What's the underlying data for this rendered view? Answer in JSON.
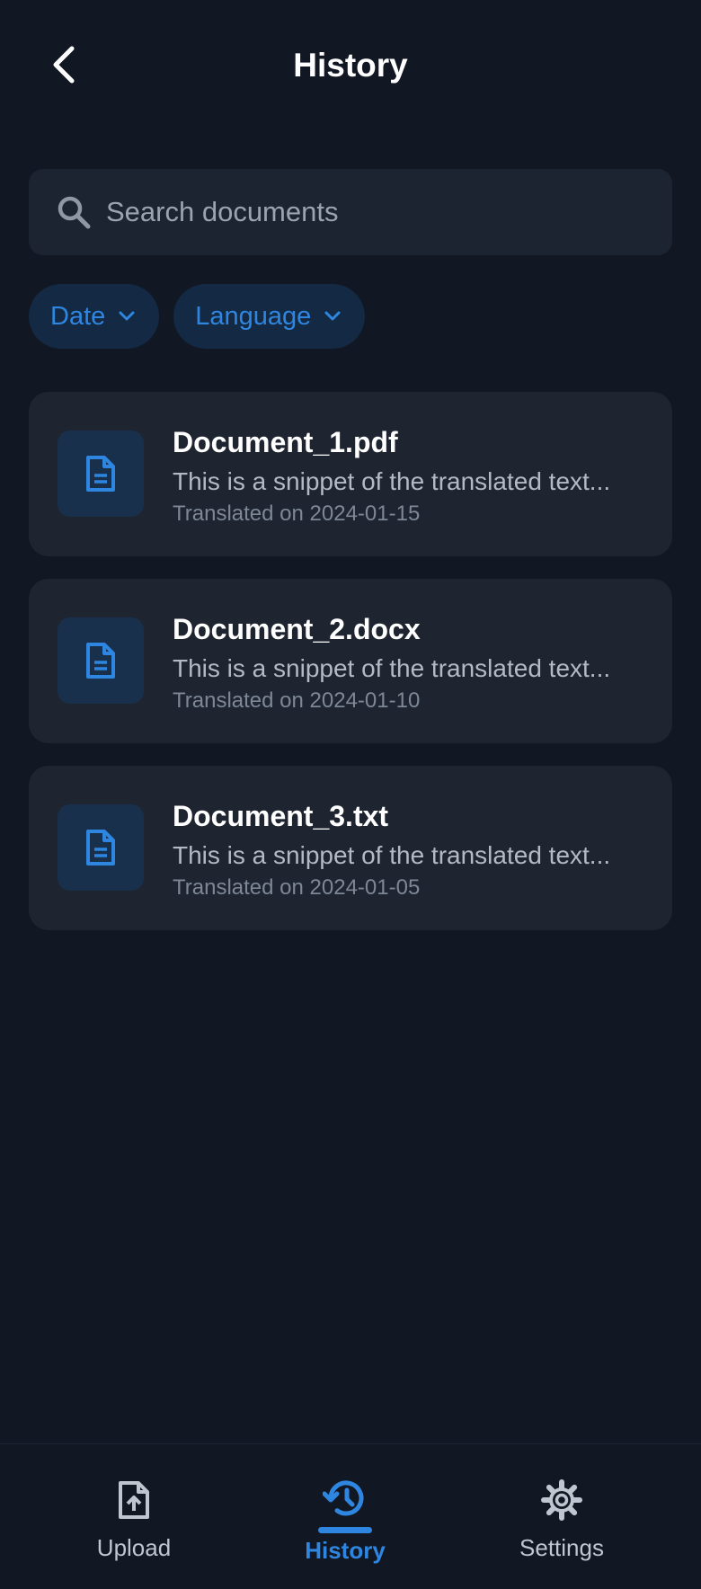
{
  "header": {
    "title": "History"
  },
  "search": {
    "placeholder": "Search documents"
  },
  "filters": [
    {
      "label": "Date"
    },
    {
      "label": "Language"
    }
  ],
  "documents": [
    {
      "name": "Document_1.pdf",
      "snippet": "This is a snippet of the translated text...",
      "date": "Translated on 2024-01-15"
    },
    {
      "name": "Document_2.docx",
      "snippet": "This is a snippet of the translated text...",
      "date": "Translated on 2024-01-10"
    },
    {
      "name": "Document_3.txt",
      "snippet": "This is a snippet of the translated text...",
      "date": "Translated on 2024-01-05"
    }
  ],
  "nav": {
    "upload": {
      "label": "Upload",
      "icon": "upload-file-icon"
    },
    "history": {
      "label": "History",
      "icon": "history-icon"
    },
    "settings": {
      "label": "Settings",
      "icon": "gear-icon"
    }
  },
  "colors": {
    "background": "#111823",
    "card": "#1e2530",
    "accent": "#2f86e0",
    "chip": "#142a44"
  }
}
